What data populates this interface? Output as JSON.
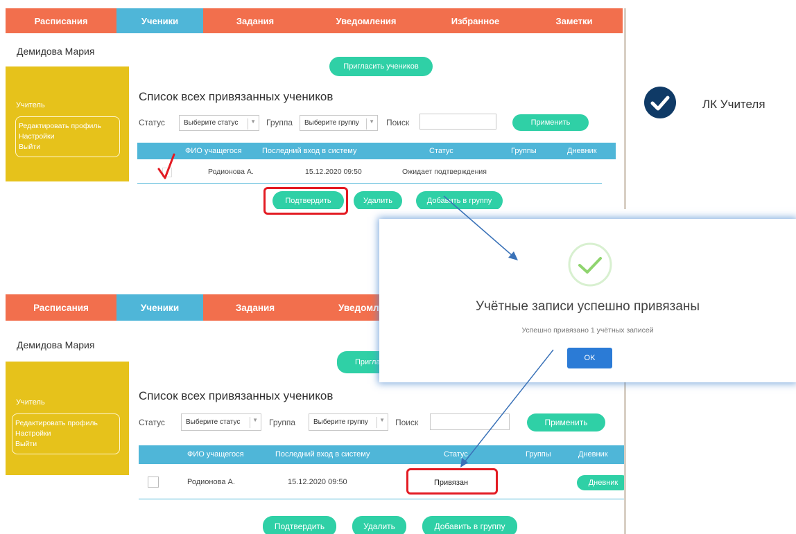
{
  "nav": {
    "tabs": [
      {
        "label": "Расписания"
      },
      {
        "label": "Ученики"
      },
      {
        "label": "Задания"
      },
      {
        "label": "Уведомления"
      },
      {
        "label": "Избранное"
      },
      {
        "label": "Заметки"
      }
    ],
    "bottom_partial_tab": "Уведомле"
  },
  "user": {
    "name": "Демидова Мария"
  },
  "sidebar": {
    "role": "Учитель",
    "menu": [
      "Редактировать профиль",
      "Настройки",
      "Выйти"
    ]
  },
  "invite_button": "Пригласить учеников",
  "invite_button_partial": "Пригла",
  "list_title": "Список всех привязанных учеников",
  "filters": {
    "status_label": "Статус",
    "status_placeholder": "Выберите статус",
    "group_label": "Группа",
    "group_placeholder": "Выберите группу",
    "search_label": "Поиск",
    "apply_button": "Применить"
  },
  "table": {
    "columns": [
      "ФИО учащегося",
      "Последний вход в систему",
      "Статус",
      "Группы",
      "Дневник"
    ]
  },
  "top_row": {
    "name": "Родионова А.",
    "last_login": "15.12.2020 09:50",
    "status": "Ожидает подтверждения"
  },
  "bottom_row": {
    "name": "Родионова А.",
    "last_login": "15.12.2020 09:50",
    "status": "Привязан",
    "diary_button": "Дневник"
  },
  "actions": {
    "confirm": "Подтвердить",
    "delete": "Удалить",
    "add_to_group": "Добавить в группу"
  },
  "modal": {
    "title": "Учётные записи успешно привязаны",
    "subtitle": "Успешно привязано 1 учётных записей",
    "ok": "OK"
  },
  "lk_label": "ЛК Учителя",
  "colors": {
    "nav_orange": "#f26f4d",
    "nav_active_blue": "#4fb6d8",
    "sidebar_yellow": "#e6c21b",
    "button_teal": "#2fd0a6",
    "highlight_red": "#e31b23",
    "ok_blue": "#2b7bd6",
    "lk_badge": "#0f3a66"
  }
}
